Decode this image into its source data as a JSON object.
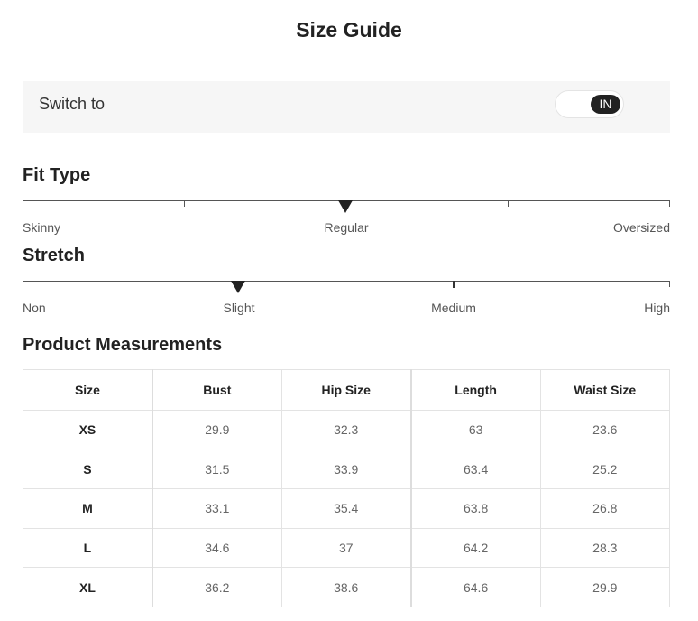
{
  "page": {
    "title": "Size Guide"
  },
  "switch": {
    "label": "Switch to",
    "toggle_value": "IN"
  },
  "fit_type": {
    "title": "Fit Type",
    "labels": [
      "Skinny",
      "Regular",
      "Oversized"
    ],
    "selected": "Regular"
  },
  "stretch": {
    "title": "Stretch",
    "labels": [
      "Non",
      "Slight",
      "Medium",
      "High"
    ],
    "selected": "Slight"
  },
  "measurements": {
    "title": "Product Measurements",
    "headers": [
      "Size",
      "Bust",
      "Hip Size",
      "Length",
      "Waist Size"
    ],
    "rows": [
      [
        "XS",
        "29.9",
        "32.3",
        "63",
        "23.6"
      ],
      [
        "S",
        "31.5",
        "33.9",
        "63.4",
        "25.2"
      ],
      [
        "M",
        "33.1",
        "35.4",
        "63.8",
        "26.8"
      ],
      [
        "L",
        "34.6",
        "37",
        "64.2",
        "28.3"
      ],
      [
        "XL",
        "36.2",
        "38.6",
        "64.6",
        "29.9"
      ]
    ]
  }
}
